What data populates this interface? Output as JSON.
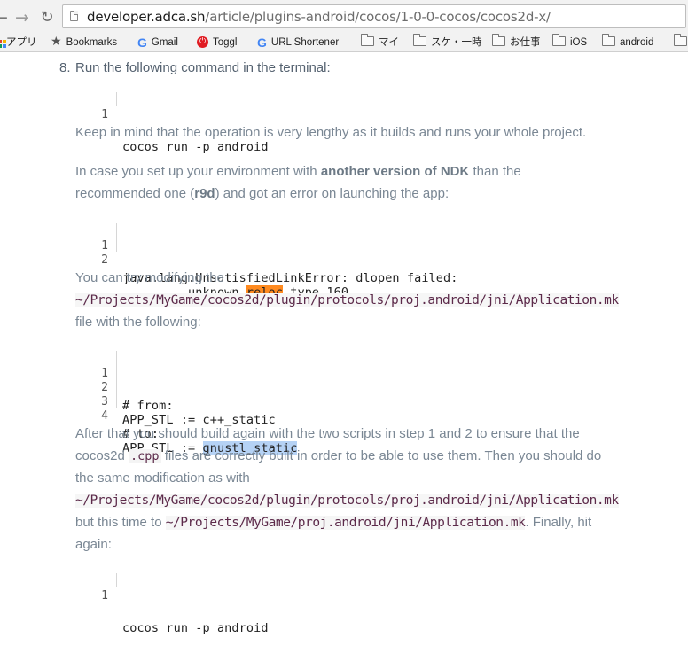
{
  "browser": {
    "url_host": "developer.adca.sh",
    "url_path": "/article/plugins-android/cocos/1-0-0-cocos/cocos2d-x/",
    "bookmarks": [
      {
        "label": "アプリ",
        "icon": "apps-grid-icon"
      },
      {
        "label": "Bookmarks",
        "icon": "star-icon"
      },
      {
        "label": "Gmail",
        "icon": "google-icon"
      },
      {
        "label": "Toggl",
        "icon": "toggl-icon"
      },
      {
        "label": "URL Shortener",
        "icon": "google-icon"
      },
      {
        "label": "マイ",
        "icon": "folder-icon"
      },
      {
        "label": "スケ・一時",
        "icon": "folder-icon"
      },
      {
        "label": "お仕事",
        "icon": "folder-icon"
      },
      {
        "label": "iOS",
        "icon": "folder-icon"
      },
      {
        "label": "android",
        "icon": "folder-icon"
      }
    ]
  },
  "article": {
    "step_number": "8.",
    "step_text": "Run the following command in the terminal:",
    "code1": [
      {
        "n": "1",
        "text": "cocos run -p android"
      }
    ],
    "p_lengthy": "Keep in mind that the operation is very lengthy as it builds and runs your whole project.",
    "p_env_1": "In case you set up your environment with ",
    "p_env_bold": "another version of NDK",
    "p_env_2": " than the",
    "p_env_3": "recommended one (",
    "p_env_r9d": "r9d",
    "p_env_4": ") and got an error on launching the app:",
    "code2": [
      {
        "n": "1",
        "pre": "java.lang.UnsatisfiedLinkError: dlopen failed:",
        "hl": "",
        "post": ""
      },
      {
        "n": "2",
        "pre": "         unknown ",
        "hl": "reloc",
        "post": " type 160"
      }
    ],
    "p_try": "You can try modifying the",
    "path_appmk": "~/Projects/MyGame/cocos2d/plugin/protocols/proj.android/jni/Application.mk",
    "p_with": "file with the following:",
    "code3": [
      {
        "n": "1",
        "pre": "# from:",
        "hl": ""
      },
      {
        "n": "2",
        "pre": "APP_STL := c++_static",
        "hl": ""
      },
      {
        "n": "3",
        "pre": "# to:",
        "hl": ""
      },
      {
        "n": "4",
        "pre": "APP_STL := ",
        "hl": "gnustl_static"
      }
    ],
    "p_after_1": "After that you should build again with the two scripts in step 1 and 2 to ensure that the",
    "p_after_2a": "cocos2d ",
    "p_after_cpp": ".cpp",
    "p_after_2b": " files are correctly built in order to be able to use them. Then you should do",
    "p_after_3": "the same modification as with",
    "path_appmk_2": "~/Projects/MyGame/cocos2d/plugin/protocols/proj.android/jni/Application.mk",
    "p_but_1": "but this time to ",
    "path_proj_mk": "~/Projects/MyGame/proj.android/jni/Application.mk",
    "p_but_2": ". Finally, hit",
    "p_again": "again:",
    "code4": [
      {
        "n": "1",
        "text": "cocos run -p android"
      }
    ]
  }
}
